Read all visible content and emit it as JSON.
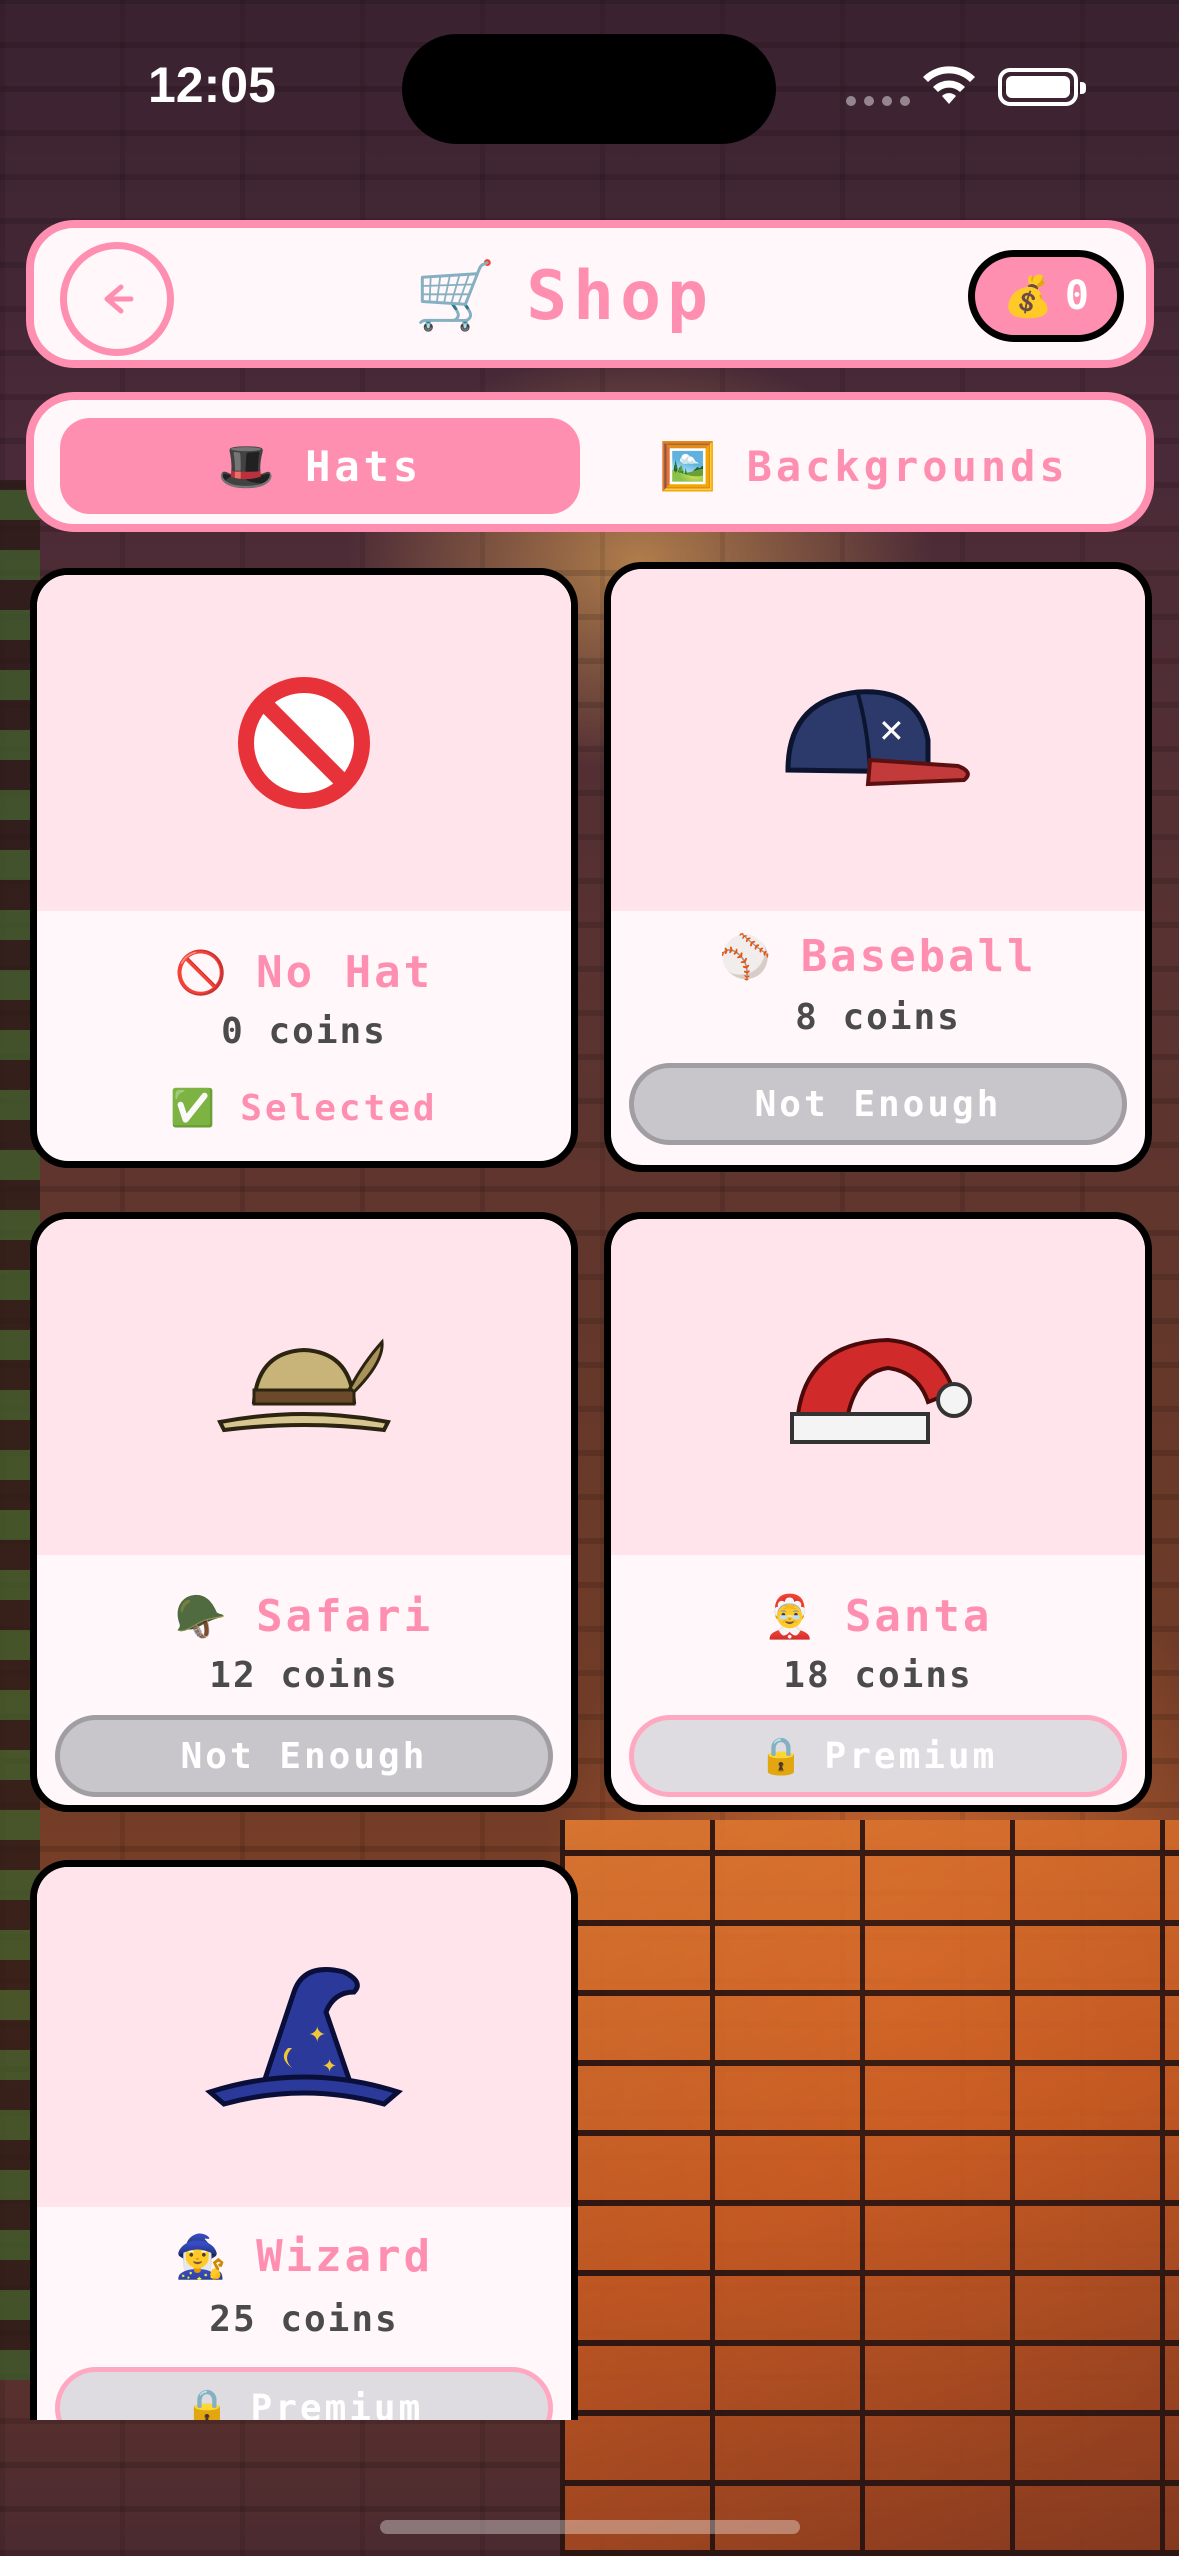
{
  "status_bar": {
    "time": "12:05"
  },
  "header": {
    "title": "Shop",
    "cart_icon": "🛒",
    "coins_icon": "💰",
    "coins": "0",
    "back_icon": "🡐"
  },
  "tabs": [
    {
      "icon": "🎩",
      "label": "Hats",
      "active": true
    },
    {
      "icon": "🖼️",
      "label": "Backgrounds",
      "active": false
    }
  ],
  "items": [
    {
      "name": "No Hat",
      "icon": "🚫",
      "price": "0 coins",
      "status_icon": "✅",
      "status": "Selected"
    },
    {
      "name": "Baseball",
      "icon": "⚾",
      "price": "8 coins",
      "button": "Not Enough"
    },
    {
      "name": "Safari",
      "icon": "🪖",
      "price": "12 coins",
      "button": "Not Enough"
    },
    {
      "name": "Santa",
      "icon": "🤶",
      "price": "18 coins",
      "button_icon": "🔒",
      "button": "Premium"
    },
    {
      "name": "Wizard",
      "icon": "🧙‍♀️",
      "price": "25 coins",
      "button_icon": "🔒",
      "button": "Premium"
    }
  ],
  "colors": {
    "accent": "#ff8fb0",
    "card_art_bg": "#ffe4ec",
    "card_bg": "#fff7f9",
    "button_gray": "#c8c6ca"
  }
}
